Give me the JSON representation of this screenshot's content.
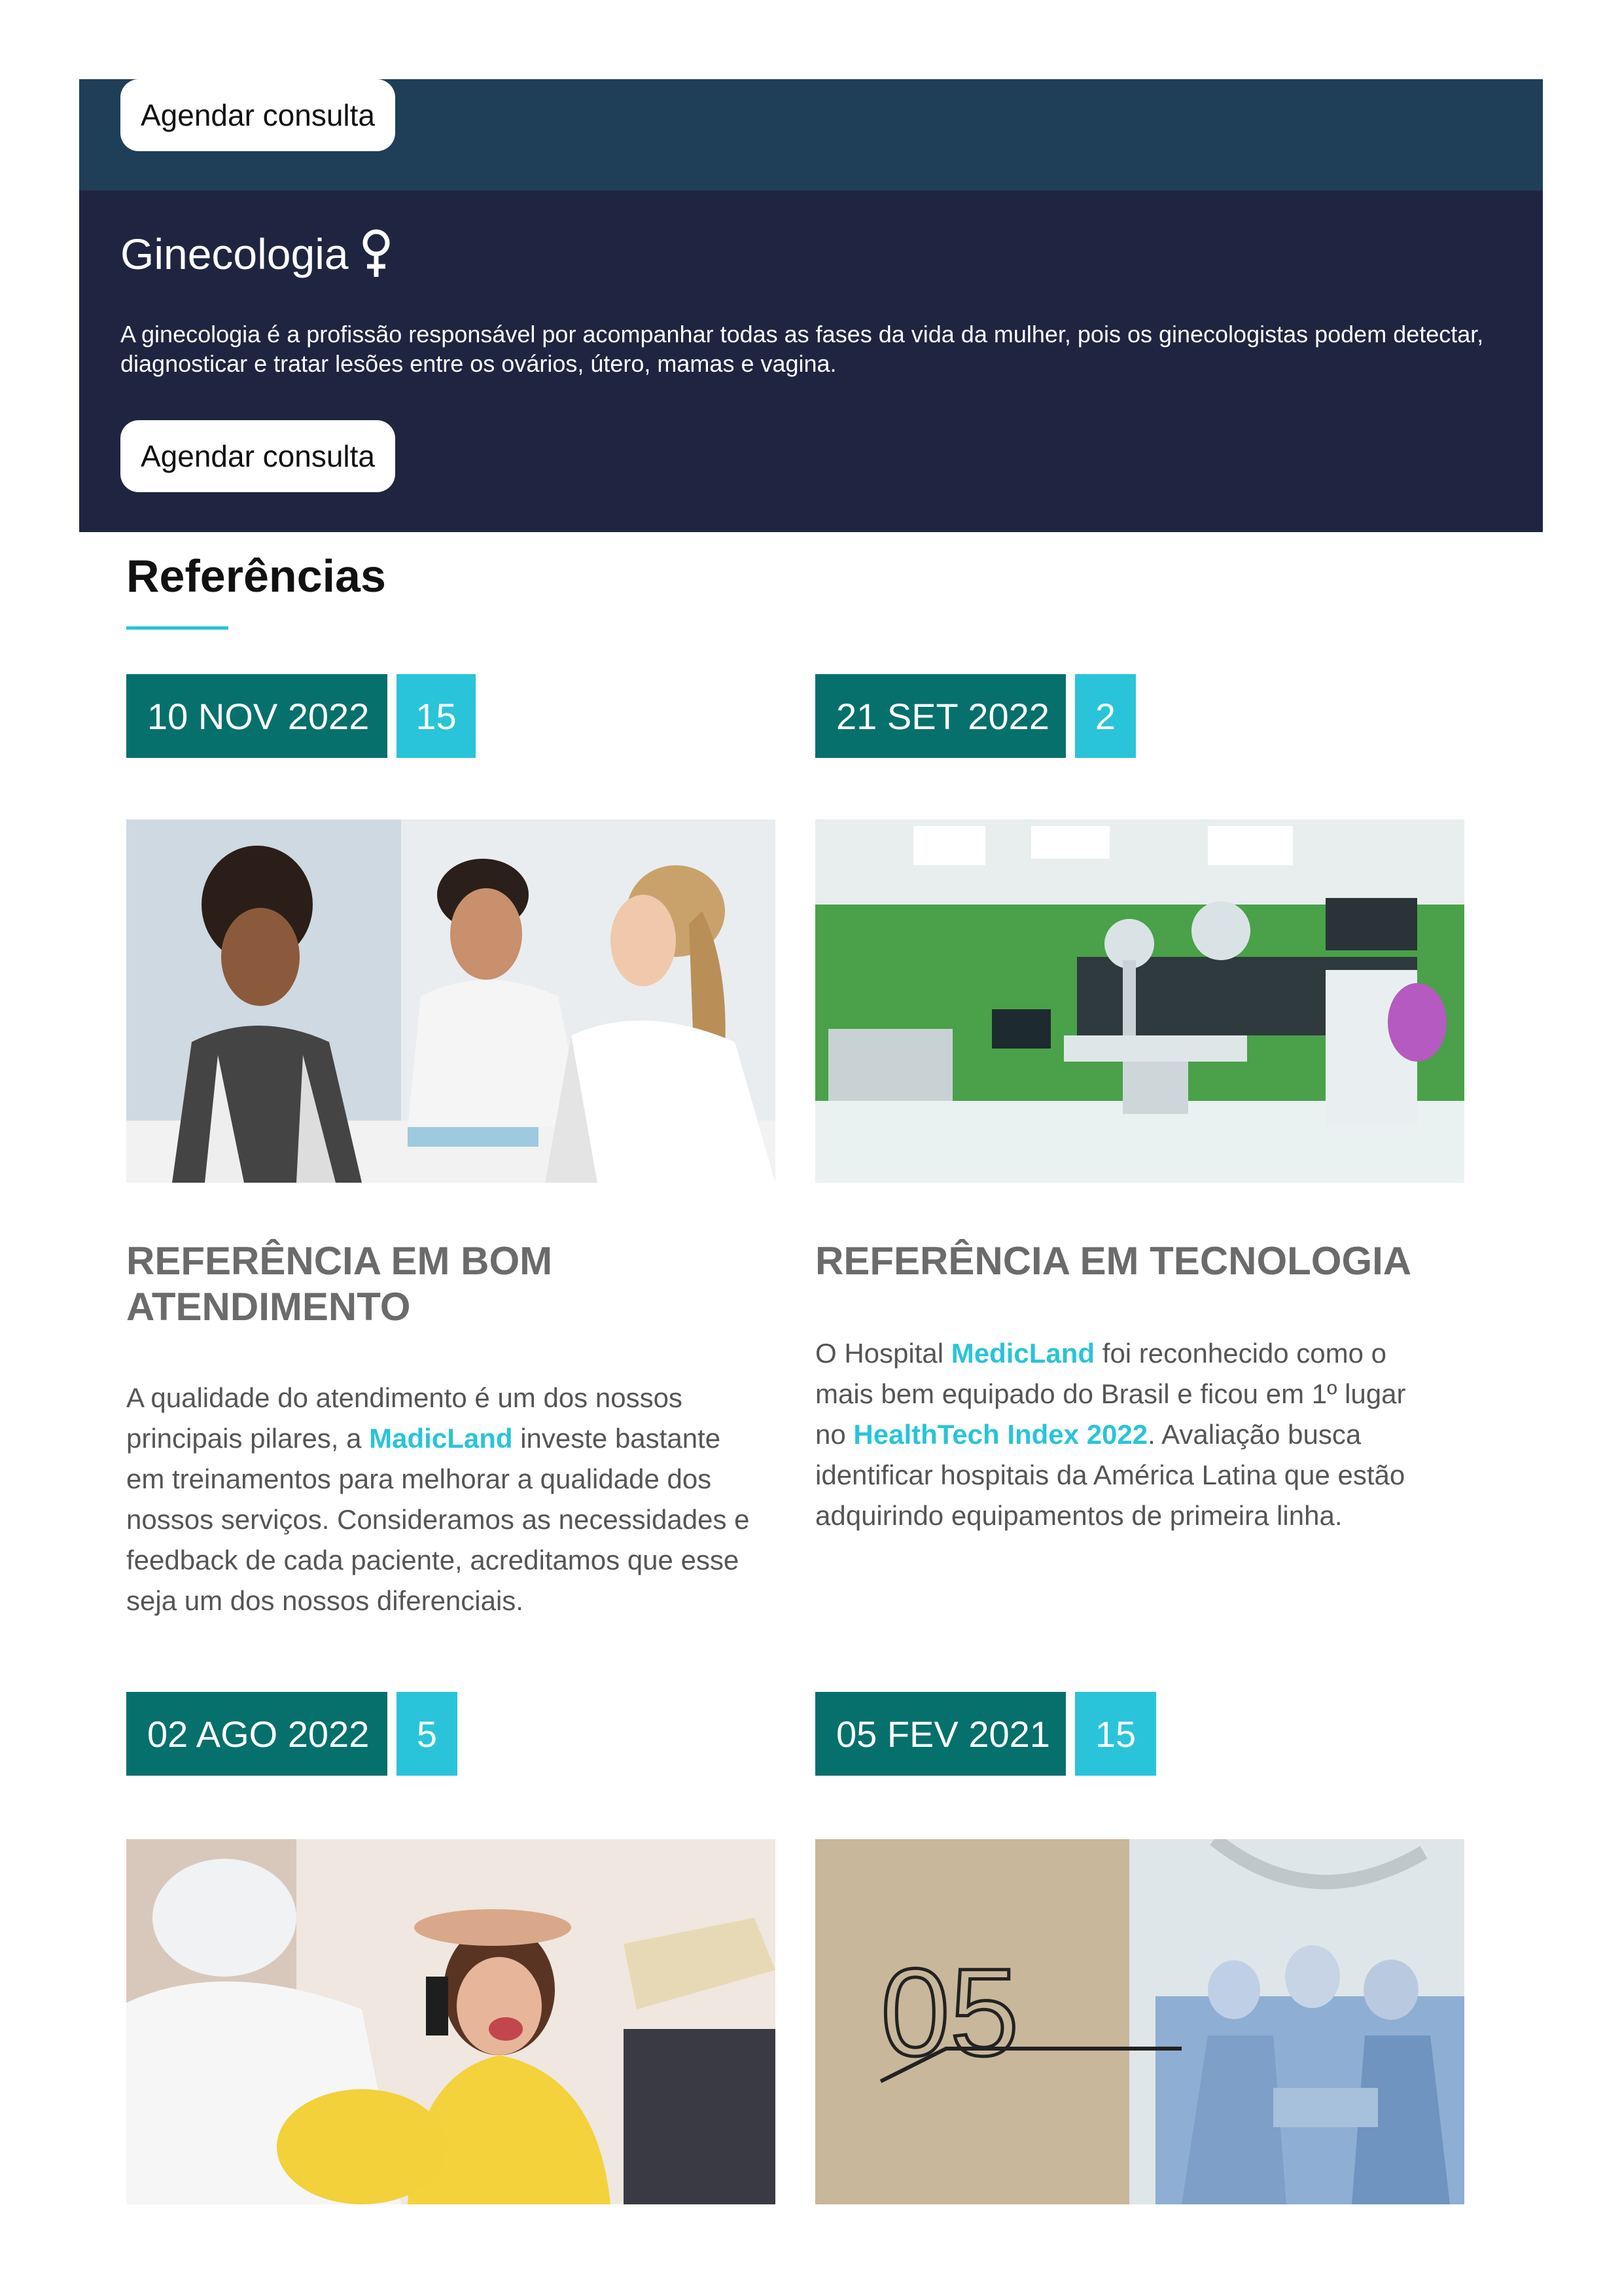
{
  "top_band": {
    "button_label": "Agendar consulta"
  },
  "gynecology": {
    "title": "Ginecologia",
    "description": "A ginecologia é a profissão responsável por acompanhar todas as fases da vida da mulher, pois os ginecologistas podem detectar, diagnosticar e tratar lesões entre os ovários, útero, mamas e vagina.",
    "button_label": "Agendar consulta",
    "icon": "venus-icon"
  },
  "references": {
    "title": "Referências",
    "cards": [
      {
        "date": "10 NOV 2022",
        "count": "15",
        "image": "family-consultation-photo",
        "title": "REFERÊNCIA EM BOM ATENDIMENTO",
        "body": {
          "p1": "A qualidade do atendimento é um dos nossos principais pilares, a ",
          "h1": "MadicLand",
          "p2": " investe bastante em treinamentos para melhorar a qualidade dos nossos serviços. Consideramos as necessidades e feedback de cada paciente, acreditamos que esse seja um dos nossos diferenciais."
        }
      },
      {
        "date": "21 SET 2022",
        "count": "2",
        "image": "operating-room-photo",
        "title": "REFERÊNCIA EM TECNOLOGIA",
        "body": {
          "p1": "O Hospital ",
          "h1": "MedicLand",
          "p2": " foi reconhecido como o mais bem equipado do Brasil e ficou em 1º lugar no ",
          "h2": "HealthTech Index 2022",
          "p3": ". Avaliação busca identificar hospitais da América Latina que estão adquirindo equipamentos de primeira linha."
        }
      },
      {
        "date": "02 AGO 2022",
        "count": "5",
        "image": "pediatric-exam-photo"
      },
      {
        "date": "05 FEV 2021",
        "count": "15",
        "image": "surgery-team-photo",
        "image_text": "05"
      }
    ]
  },
  "colors": {
    "top_band": "#1f3f58",
    "gyn_band": "#1f2540",
    "date_badge": "#06706c",
    "count_badge": "#29c4d9",
    "highlight": "#29c4d9",
    "heading_gray": "#6b6b6b"
  }
}
